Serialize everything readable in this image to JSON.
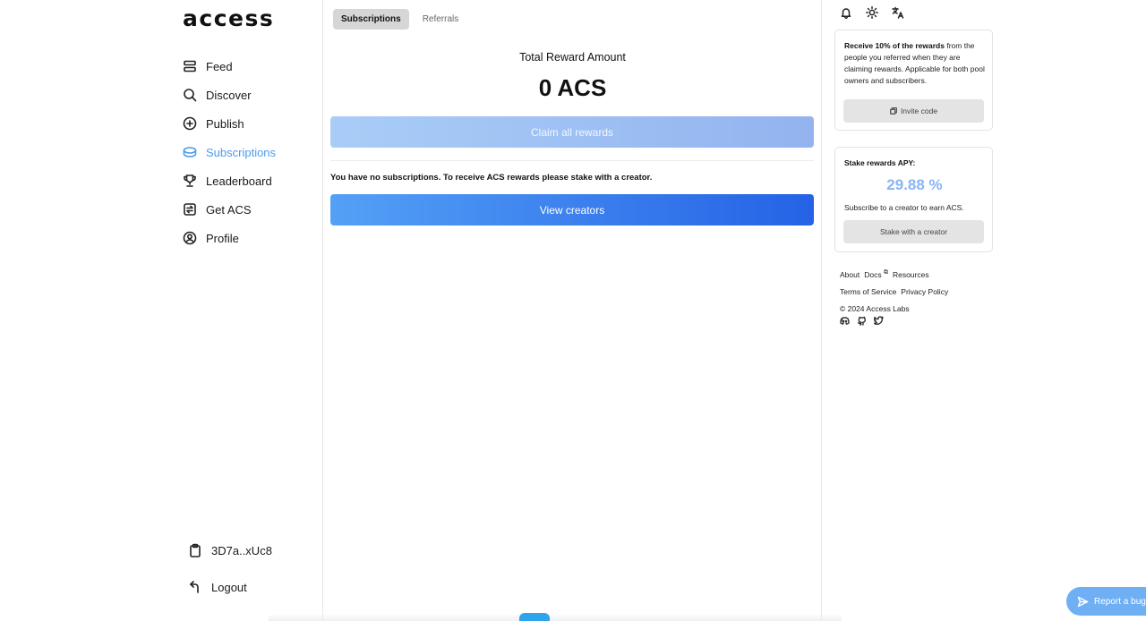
{
  "brand": {
    "logo_text": "access"
  },
  "sidebar": {
    "items": [
      {
        "label": "Feed",
        "icon": "feed-icon"
      },
      {
        "label": "Discover",
        "icon": "search-icon"
      },
      {
        "label": "Publish",
        "icon": "plus-circle-icon"
      },
      {
        "label": "Subscriptions",
        "icon": "coins-icon",
        "active": true
      },
      {
        "label": "Leaderboard",
        "icon": "trophy-icon"
      },
      {
        "label": "Get ACS",
        "icon": "swap-icon"
      },
      {
        "label": "Profile",
        "icon": "user-circle-icon"
      }
    ],
    "wallet_address": "3D7a..xUc8",
    "logout_label": "Logout"
  },
  "main": {
    "tabs": [
      {
        "label": "Subscriptions",
        "active": true
      },
      {
        "label": "Referrals",
        "active": false
      }
    ],
    "reward_title": "Total Reward Amount",
    "reward_amount": "0 ACS",
    "claim_label": "Claim all rewards",
    "no_subscriptions_text": "You have no subscriptions. To receive ACS rewards please stake with a creator.",
    "view_creators_label": "View creators"
  },
  "right": {
    "referral_card": {
      "bold_text": "Receive 10% of the rewards",
      "rest_text": " from the people you referred when they are claiming rewards. Applicable for both pool owners and subscribers.",
      "button_label": "Invite code"
    },
    "stake_card": {
      "title": "Stake rewards APY:",
      "apy": "29.88 %",
      "subtitle": "Subscribe to a creator to earn ACS.",
      "button_label": "Stake with a creator"
    },
    "footer": {
      "about": "About",
      "docs": "Docs",
      "resources": "Resources",
      "terms": "Terms of Service",
      "privacy": "Privacy Policy",
      "copyright": "© 2024 Access Labs"
    }
  },
  "report_bug_label": "Report a bug",
  "colors": {
    "accent": "#4d9be8",
    "primary_button": "#2562e6",
    "apy": "#87b6f3"
  }
}
